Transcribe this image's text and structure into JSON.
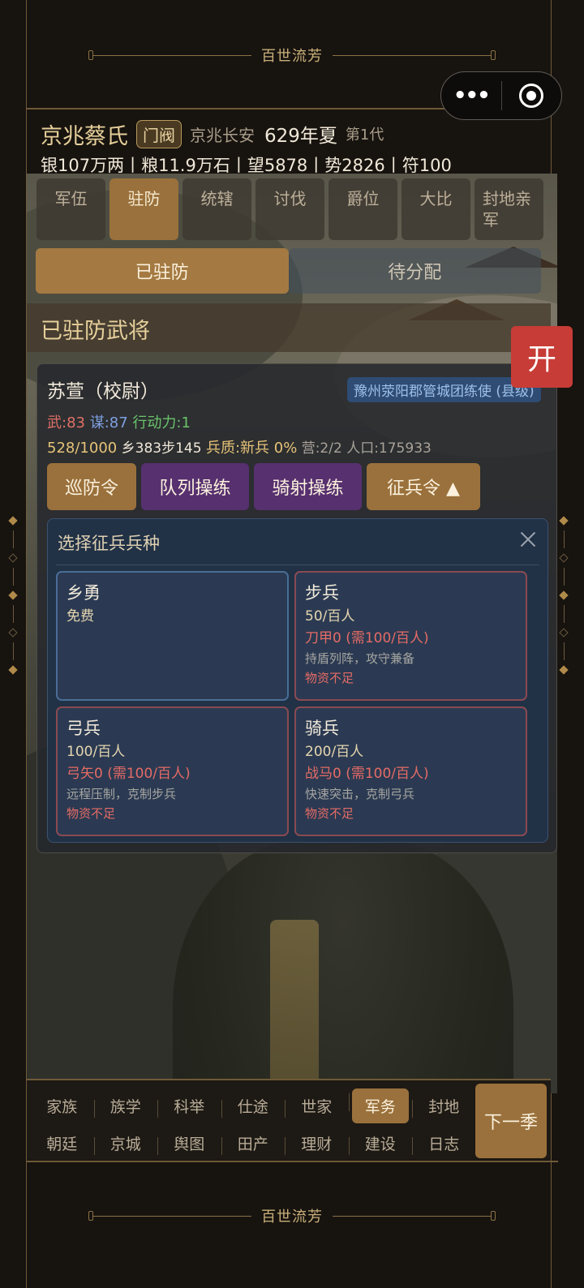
{
  "banner": {
    "title": "百世流芳"
  },
  "header": {
    "clan": "京兆蔡氏",
    "rank": "门阀",
    "place": "京兆长安",
    "year": "629年夏",
    "generation": "第1代",
    "resources": "银107万两丨粮11.9万石丨望5878丨势2826丨符100"
  },
  "tabs": [
    {
      "label": "军伍"
    },
    {
      "label": "驻防",
      "active": true
    },
    {
      "label": "统辖"
    },
    {
      "label": "讨伐"
    },
    {
      "label": "爵位"
    },
    {
      "label": "大比"
    },
    {
      "label": "封地亲军"
    }
  ],
  "subtabs": {
    "garrisoned": "已驻防",
    "unassigned": "待分配"
  },
  "section_title": "已驻防武将",
  "open_button": "开",
  "general": {
    "name": "苏萱（校尉）",
    "post": "豫州荥阳郡管城团练使 (县级)",
    "force": "武:83",
    "strategy": "谋:87",
    "action": "行动力:1",
    "troops": "528/1000",
    "composition": "乡383步145",
    "quality": "兵质:新兵 0%",
    "camp": "营:2/2",
    "population": "人口:175933"
  },
  "actions": {
    "patrol": "巡防令",
    "formation": "队列操练",
    "archery": "骑射操练",
    "conscript": "征兵令 ▲"
  },
  "conscript_panel": {
    "title": "选择征兵兵种",
    "options": [
      {
        "name": "乡勇",
        "cost": "免费"
      },
      {
        "name": "步兵",
        "cost": "50/百人",
        "need": "刀甲0 (需100/百人)",
        "desc": "持盾列阵，攻守兼备",
        "warn": "物资不足"
      },
      {
        "name": "弓兵",
        "cost": "100/百人",
        "need": "弓矢0 (需100/百人)",
        "desc": "远程压制，克制步兵",
        "warn": "物资不足"
      },
      {
        "name": "骑兵",
        "cost": "200/百人",
        "need": "战马0 (需100/百人)",
        "desc": "快速突击，克制弓兵",
        "warn": "物资不足"
      }
    ]
  },
  "bottom_nav": {
    "row1": [
      "家族",
      "族学",
      "科举",
      "仕途",
      "世家",
      "军务",
      "封地"
    ],
    "row2": [
      "朝廷",
      "京城",
      "舆图",
      "田产",
      "理财",
      "建设",
      "日志"
    ],
    "next": "下一季"
  },
  "colors": {
    "gold": "#9a713c",
    "purple": "#56306f",
    "alert_red": "#c73c36",
    "panel_blue": "#213146"
  }
}
